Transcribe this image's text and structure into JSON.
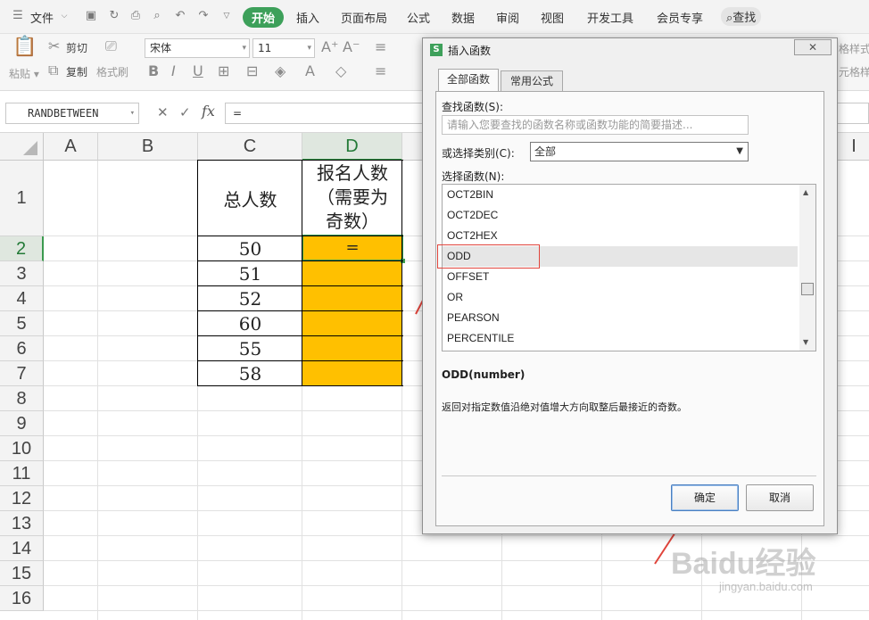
{
  "menubar": {
    "file_label": "文件",
    "tabs": [
      "开始",
      "插入",
      "页面布局",
      "公式",
      "数据",
      "审阅",
      "视图",
      "开发工具",
      "会员专享"
    ],
    "search_label": "查找"
  },
  "ribbon": {
    "paste": "粘贴",
    "cut": "剪切",
    "copy": "复制",
    "format_painter": "格式刷",
    "font_name": "宋体",
    "font_size": "11",
    "right_clip_1": "格样式",
    "right_clip_2": "元格样"
  },
  "formula_bar": {
    "name_box": "RANDBETWEEN",
    "fx": "fx",
    "value": "="
  },
  "sheet": {
    "columns": [
      "A",
      "B",
      "C",
      "D"
    ],
    "extra_col": "I",
    "rows": [
      "1",
      "2",
      "3",
      "4",
      "5",
      "6",
      "7",
      "8",
      "9",
      "10",
      "11",
      "12",
      "13",
      "14",
      "15",
      "16"
    ],
    "c1": "总人数",
    "d1_lines": [
      "报名人数",
      "（需要为",
      "奇数）"
    ],
    "c_values": [
      "50",
      "51",
      "52",
      "60",
      "55",
      "58"
    ],
    "d2": "="
  },
  "dialog": {
    "title": "插入函数",
    "tabs": [
      "全部函数",
      "常用公式"
    ],
    "search_label": "查找函数(S):",
    "search_placeholder": "请输入您要查找的函数名称或函数功能的简要描述...",
    "category_label": "或选择类别(C):",
    "category_value": "全部",
    "func_label": "选择函数(N):",
    "functions": [
      "OCT2BIN",
      "OCT2DEC",
      "OCT2HEX",
      "ODD",
      "OFFSET",
      "OR",
      "PEARSON",
      "PERCENTILE"
    ],
    "selected_function": "ODD",
    "signature": "ODD(number)",
    "description": "返回对指定数值沿绝对值增大方向取整后最接近的奇数。",
    "ok": "确定",
    "cancel": "取消"
  },
  "watermark": {
    "logo": "Baidu经验",
    "url": "jingyan.baidu.com"
  },
  "colors": {
    "accent_green": "#3da05a",
    "cell_fill": "#ffc000",
    "annotation_red": "#e0443b"
  }
}
